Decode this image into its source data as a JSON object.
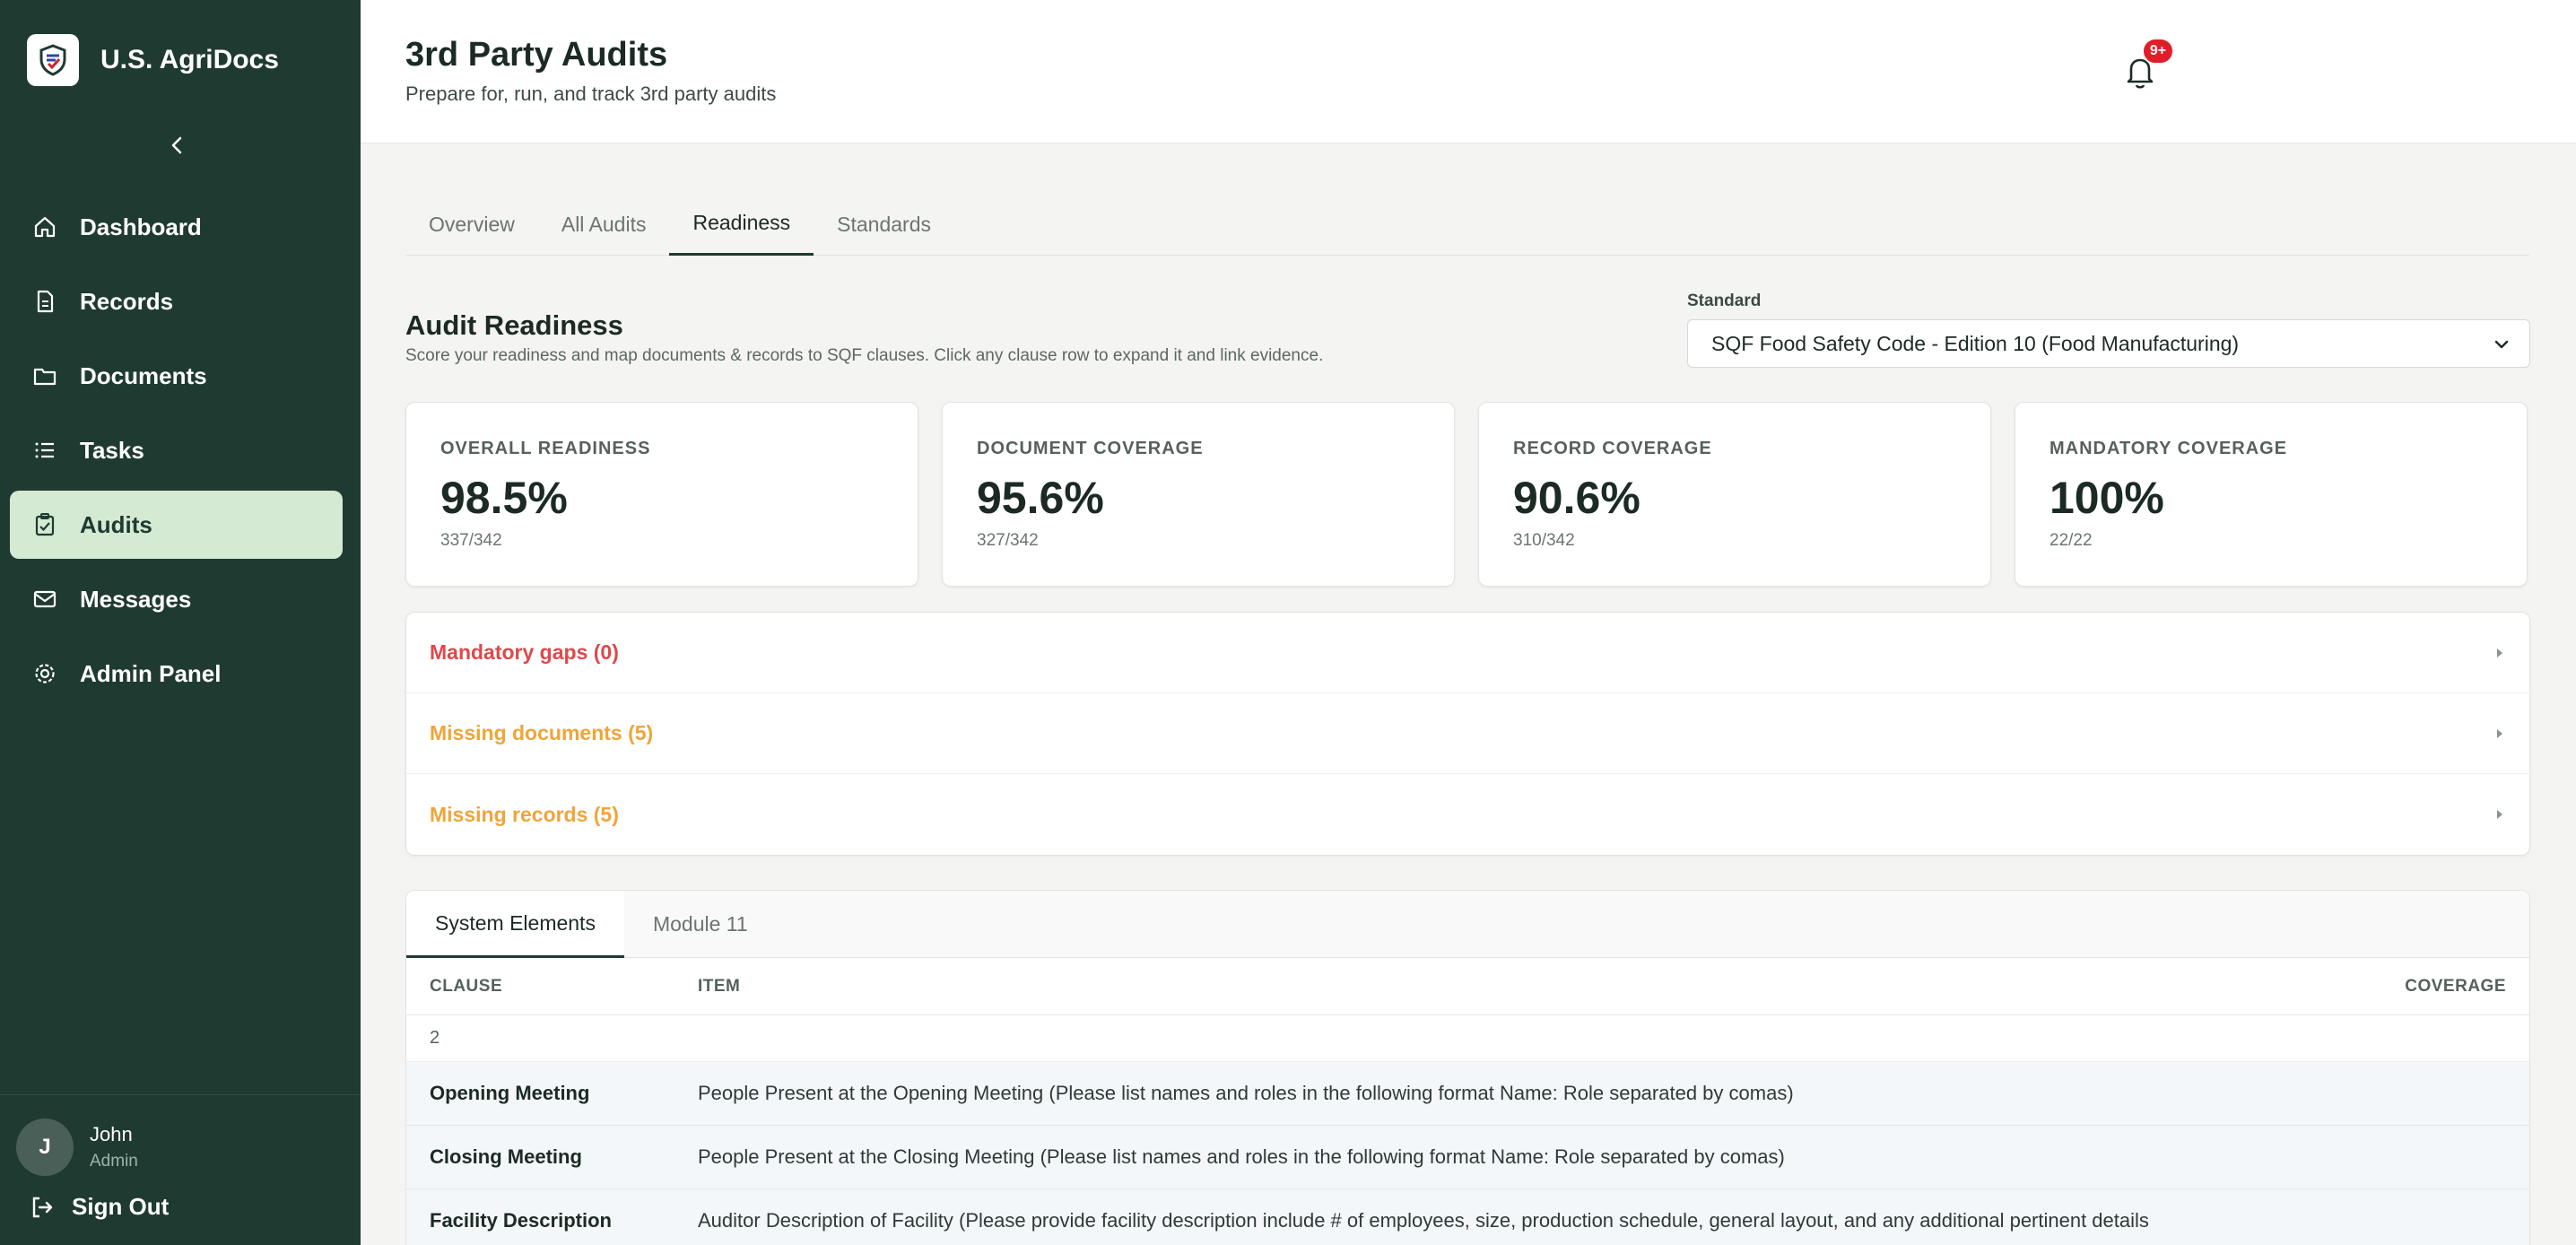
{
  "app": {
    "name": "U.S. AgriDocs"
  },
  "sidebar": {
    "items": [
      {
        "label": "Dashboard",
        "icon": "home-icon",
        "active": false
      },
      {
        "label": "Records",
        "icon": "file-icon",
        "active": false
      },
      {
        "label": "Documents",
        "icon": "folder-icon",
        "active": false
      },
      {
        "label": "Tasks",
        "icon": "list-icon",
        "active": false
      },
      {
        "label": "Audits",
        "icon": "clipboard-check-icon",
        "active": true
      },
      {
        "label": "Messages",
        "icon": "mail-icon",
        "active": false
      },
      {
        "label": "Admin Panel",
        "icon": "gear-icon",
        "active": false
      }
    ],
    "user": {
      "initial": "J",
      "name": "John",
      "role": "Admin"
    },
    "signout_label": "Sign Out"
  },
  "header": {
    "title": "3rd Party Audits",
    "subtitle": "Prepare for, run, and track 3rd party audits",
    "notification_badge": "9+"
  },
  "tabs": [
    "Overview",
    "All Audits",
    "Readiness",
    "Standards"
  ],
  "active_tab": "Readiness",
  "readiness": {
    "title": "Audit Readiness",
    "description": "Score your readiness and map documents & records to SQF clauses. Click any clause row to expand it and link evidence.",
    "standard_label": "Standard",
    "standard_value": "SQF Food Safety Code - Edition 10 (Food Manufacturing)"
  },
  "cards": [
    {
      "label": "OVERALL READINESS",
      "value": "98.5%",
      "sub": "337/342"
    },
    {
      "label": "DOCUMENT COVERAGE",
      "value": "95.6%",
      "sub": "327/342"
    },
    {
      "label": "RECORD COVERAGE",
      "value": "90.6%",
      "sub": "310/342"
    },
    {
      "label": "MANDATORY COVERAGE",
      "value": "100%",
      "sub": "22/22"
    }
  ],
  "gaps": [
    {
      "label": "Mandatory gaps (0)",
      "color": "#e0484b"
    },
    {
      "label": "Missing documents (5)",
      "color": "#efa53a"
    },
    {
      "label": "Missing records (5)",
      "color": "#efa53a"
    }
  ],
  "clause_table": {
    "subtabs": [
      "System Elements",
      "Module 11"
    ],
    "active_subtab": "System Elements",
    "columns": {
      "clause": "CLAUSE",
      "item": "ITEM",
      "coverage": "COVERAGE"
    },
    "group": "2",
    "rows": [
      {
        "clause": "Opening Meeting",
        "item": "People Present at the Opening Meeting (Please list names and roles in the following format Name: Role separated by comas)"
      },
      {
        "clause": "Closing Meeting",
        "item": "People Present at the Closing Meeting (Please list names and roles in the following format Name: Role separated by comas)"
      },
      {
        "clause": "Facility Description",
        "item": "Auditor Description of Facility (Please provide facility description include # of employees, size, production schedule, general layout, and any additional pertinent details"
      }
    ]
  }
}
